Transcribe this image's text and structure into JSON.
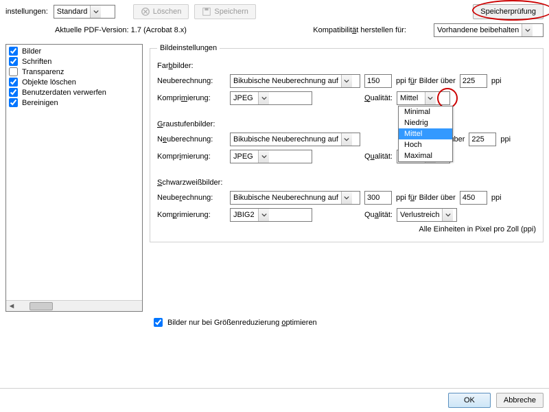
{
  "topbar": {
    "settings_label": "instellungen:",
    "settings_value": "Standard",
    "delete_label": "Löschen",
    "save_label": "Speichern",
    "memcheck_label": "Speicherprüfung"
  },
  "info": {
    "version_label": "Aktuelle PDF-Version: 1.7 (Acrobat 8.x)",
    "compat_label": "Kompatibilität herstellen für:",
    "compat_value": "Vorhandene beibehalten"
  },
  "sidebar": {
    "items": [
      {
        "label": "Bilder",
        "checked": true
      },
      {
        "label": "Schriften",
        "checked": true
      },
      {
        "label": "Transparenz",
        "checked": false
      },
      {
        "label": "Objekte löschen",
        "checked": true
      },
      {
        "label": "Benutzerdaten verwerfen",
        "checked": true
      },
      {
        "label": "Bereinigen",
        "checked": true
      }
    ]
  },
  "panel": {
    "legend": "Bildeinstellungen",
    "sections": {
      "color": {
        "title": "Farbbilder:",
        "recalc_label": "Neuberechnung:",
        "recalc_value": "Bikubische Neuberechnung auf",
        "ppi1": "150",
        "over_label": "ppi für Bilder über",
        "ppi2": "225",
        "ppi_unit": "ppi",
        "compress_label": "Komprimierung:",
        "compress_value": "JPEG",
        "quality_label": "Qualität:",
        "quality_value": "Mittel"
      },
      "gray": {
        "title": "Graustufenbilder:",
        "recalc_label": "Neuberechnung:",
        "recalc_value": "Bikubische Neuberechnung auf",
        "over_label": "lder über",
        "ppi2": "225",
        "ppi_unit": "ppi",
        "compress_label": "Komprimierung:",
        "compress_value": "JPEG",
        "quality_label": "Qualität:",
        "quality_value": "Mittel"
      },
      "bw": {
        "title": "Schwarzweißbilder:",
        "recalc_label": "Neuberechnung:",
        "recalc_value": "Bikubische Neuberechnung auf",
        "ppi1": "300",
        "over_label": "ppi für Bilder über",
        "ppi2": "450",
        "ppi_unit": "ppi",
        "compress_label": "Komprimierung:",
        "compress_value": "JBIG2",
        "quality_label": "Qualität:",
        "quality_value": "Verlustreich"
      }
    },
    "quality_options": [
      "Minimal",
      "Niedrig",
      "Mittel",
      "Hoch",
      "Maximal"
    ],
    "units_note": "Alle Einheiten in Pixel pro Zoll (ppi)",
    "optimize_checkbox": "Bilder nur bei Größenreduzierung optimieren",
    "optimize_checked": true
  },
  "footer": {
    "ok": "OK",
    "cancel": "Abbreche"
  }
}
